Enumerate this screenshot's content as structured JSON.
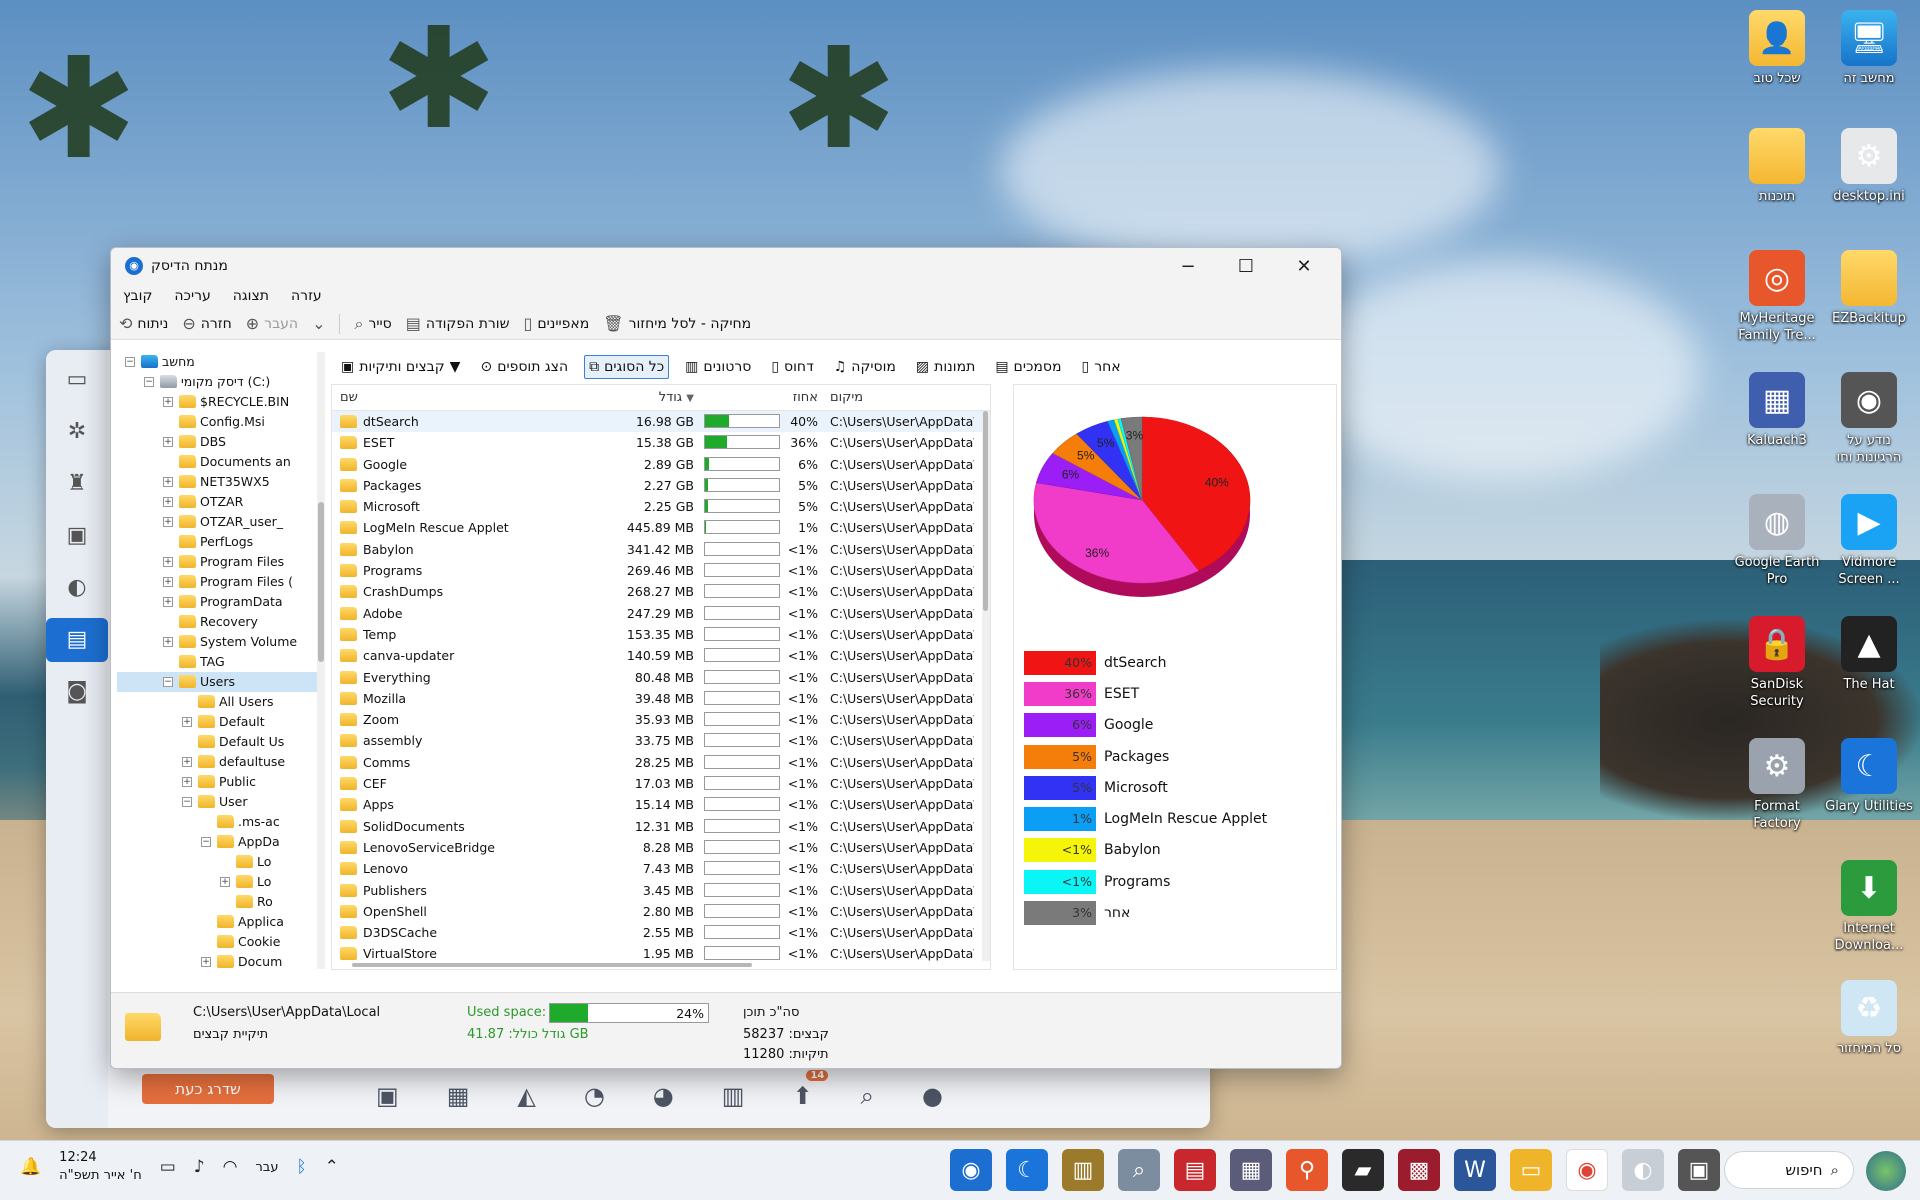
{
  "window": {
    "title": "מנתח הדיסק",
    "menu": [
      "קובץ",
      "עריכה",
      "תצוגה",
      "עזרה"
    ],
    "toolbar": {
      "analyze": "ניתוח",
      "back": "חזרה",
      "forward": "העבר",
      "explore": "סייר",
      "command_line": "שורת הפקודה",
      "properties": "מאפיינים",
      "recycle": "מחיקה - לסל מיחזור"
    },
    "category_tabs": {
      "files_folders": "קבצים ותיקיות",
      "show_extras": "הצג תוספים",
      "all_types": "כל הסוגים",
      "videos": "סרטונים",
      "reports": "דחוס",
      "music": "מוסיקה",
      "images": "תמונות",
      "documents": "מסמכים",
      "other": "אחר"
    }
  },
  "tree": {
    "items": [
      {
        "label": "מחשב",
        "level": 0,
        "exp": "−",
        "kind": "computer"
      },
      {
        "label": "דיסק מקומי (C:)",
        "level": 1,
        "exp": "−",
        "kind": "drive"
      },
      {
        "label": "$RECYCLE.BIN",
        "level": 2,
        "exp": "+"
      },
      {
        "label": "Config.Msi",
        "level": 2,
        "exp": ""
      },
      {
        "label": "DBS",
        "level": 2,
        "exp": "+"
      },
      {
        "label": "Documents an",
        "level": 2,
        "exp": ""
      },
      {
        "label": "NET35WX5",
        "level": 2,
        "exp": "+"
      },
      {
        "label": "OTZAR",
        "level": 2,
        "exp": "+"
      },
      {
        "label": "OTZAR_user_",
        "level": 2,
        "exp": "+"
      },
      {
        "label": "PerfLogs",
        "level": 2,
        "exp": ""
      },
      {
        "label": "Program Files",
        "level": 2,
        "exp": "+"
      },
      {
        "label": "Program Files (",
        "level": 2,
        "exp": "+"
      },
      {
        "label": "ProgramData",
        "level": 2,
        "exp": "+"
      },
      {
        "label": "Recovery",
        "level": 2,
        "exp": ""
      },
      {
        "label": "System Volume",
        "level": 2,
        "exp": "+"
      },
      {
        "label": "TAG",
        "level": 2,
        "exp": ""
      },
      {
        "label": "Users",
        "level": 2,
        "exp": "−",
        "selected": true
      },
      {
        "label": "All Users",
        "level": 3,
        "exp": ""
      },
      {
        "label": "Default",
        "level": 3,
        "exp": "+"
      },
      {
        "label": "Default Us",
        "level": 3,
        "exp": ""
      },
      {
        "label": "defaultuse",
        "level": 3,
        "exp": "+"
      },
      {
        "label": "Public",
        "level": 3,
        "exp": "+"
      },
      {
        "label": "User",
        "level": 3,
        "exp": "−"
      },
      {
        "label": ".ms-ac",
        "level": 4,
        "exp": ""
      },
      {
        "label": "AppDa",
        "level": 4,
        "exp": "−"
      },
      {
        "label": "Lo",
        "level": 5,
        "exp": ""
      },
      {
        "label": "Lo",
        "level": 5,
        "exp": "+"
      },
      {
        "label": "Ro",
        "level": 5,
        "exp": ""
      },
      {
        "label": "Applica",
        "level": 4,
        "exp": ""
      },
      {
        "label": "Cookie",
        "level": 4,
        "exp": ""
      },
      {
        "label": "Docum",
        "level": 4,
        "exp": "+"
      }
    ]
  },
  "list": {
    "headers": {
      "name": "שם",
      "size": "גודל",
      "pct": "אחוז",
      "location": "מיקום"
    },
    "rows": [
      {
        "name": "dtSearch",
        "size": "16.98 GB",
        "pct": "40%",
        "share": 0.4,
        "loc": "C:\\Users\\User\\AppData\\"
      },
      {
        "name": "ESET",
        "size": "15.38 GB",
        "pct": "36%",
        "share": 0.36,
        "loc": "C:\\Users\\User\\AppData\\"
      },
      {
        "name": "Google",
        "size": "2.89 GB",
        "pct": "6%",
        "share": 0.06,
        "loc": "C:\\Users\\User\\AppData\\"
      },
      {
        "name": "Packages",
        "size": "2.27 GB",
        "pct": "5%",
        "share": 0.05,
        "loc": "C:\\Users\\User\\AppData\\"
      },
      {
        "name": "Microsoft",
        "size": "2.25 GB",
        "pct": "5%",
        "share": 0.05,
        "loc": "C:\\Users\\User\\AppData\\"
      },
      {
        "name": "LogMeIn Rescue Applet",
        "size": "445.89 MB",
        "pct": "1%",
        "share": 0.01,
        "loc": "C:\\Users\\User\\AppData\\"
      },
      {
        "name": "Babylon",
        "size": "341.42 MB",
        "pct": "<1%",
        "share": 0.0,
        "loc": "C:\\Users\\User\\AppData\\"
      },
      {
        "name": "Programs",
        "size": "269.46 MB",
        "pct": "<1%",
        "share": 0.0,
        "loc": "C:\\Users\\User\\AppData\\"
      },
      {
        "name": "CrashDumps",
        "size": "268.27 MB",
        "pct": "<1%",
        "share": 0.0,
        "loc": "C:\\Users\\User\\AppData\\"
      },
      {
        "name": "Adobe",
        "size": "247.29 MB",
        "pct": "<1%",
        "share": 0.0,
        "loc": "C:\\Users\\User\\AppData\\"
      },
      {
        "name": "Temp",
        "size": "153.35 MB",
        "pct": "<1%",
        "share": 0.0,
        "loc": "C:\\Users\\User\\AppData\\"
      },
      {
        "name": "canva-updater",
        "size": "140.59 MB",
        "pct": "<1%",
        "share": 0.0,
        "loc": "C:\\Users\\User\\AppData\\"
      },
      {
        "name": "Everything",
        "size": "80.48 MB",
        "pct": "<1%",
        "share": 0.0,
        "loc": "C:\\Users\\User\\AppData\\"
      },
      {
        "name": "Mozilla",
        "size": "39.48 MB",
        "pct": "<1%",
        "share": 0.0,
        "loc": "C:\\Users\\User\\AppData\\"
      },
      {
        "name": "Zoom",
        "size": "35.93 MB",
        "pct": "<1%",
        "share": 0.0,
        "loc": "C:\\Users\\User\\AppData\\"
      },
      {
        "name": "assembly",
        "size": "33.75 MB",
        "pct": "<1%",
        "share": 0.0,
        "loc": "C:\\Users\\User\\AppData\\"
      },
      {
        "name": "Comms",
        "size": "28.25 MB",
        "pct": "<1%",
        "share": 0.0,
        "loc": "C:\\Users\\User\\AppData\\"
      },
      {
        "name": "CEF",
        "size": "17.03 MB",
        "pct": "<1%",
        "share": 0.0,
        "loc": "C:\\Users\\User\\AppData\\"
      },
      {
        "name": "Apps",
        "size": "15.14 MB",
        "pct": "<1%",
        "share": 0.0,
        "loc": "C:\\Users\\User\\AppData\\"
      },
      {
        "name": "SolidDocuments",
        "size": "12.31 MB",
        "pct": "<1%",
        "share": 0.0,
        "loc": "C:\\Users\\User\\AppData\\"
      },
      {
        "name": "LenovoServiceBridge",
        "size": "8.28 MB",
        "pct": "<1%",
        "share": 0.0,
        "loc": "C:\\Users\\User\\AppData\\"
      },
      {
        "name": "Lenovo",
        "size": "7.43 MB",
        "pct": "<1%",
        "share": 0.0,
        "loc": "C:\\Users\\User\\AppData\\"
      },
      {
        "name": "Publishers",
        "size": "3.45 MB",
        "pct": "<1%",
        "share": 0.0,
        "loc": "C:\\Users\\User\\AppData\\"
      },
      {
        "name": "OpenShell",
        "size": "2.80 MB",
        "pct": "<1%",
        "share": 0.0,
        "loc": "C:\\Users\\User\\AppData\\"
      },
      {
        "name": "D3DSCache",
        "size": "2.55 MB",
        "pct": "<1%",
        "share": 0.0,
        "loc": "C:\\Users\\User\\AppData\\"
      },
      {
        "name": "VirtualStore",
        "size": "1.95 MB",
        "pct": "<1%",
        "share": 0.0,
        "loc": "C:\\Users\\User\\AppData\\"
      }
    ]
  },
  "chart_data": {
    "type": "pie",
    "slices": [
      {
        "name": "dtSearch",
        "value": 40,
        "label": "40%",
        "color": "#f01414"
      },
      {
        "name": "ESET",
        "value": 36,
        "label": "36%",
        "color": "#f03cc8"
      },
      {
        "name": "Google",
        "value": 6,
        "label": "6%",
        "color": "#9a1ef5"
      },
      {
        "name": "Packages",
        "value": 5,
        "label": "5%",
        "color": "#f57d0a"
      },
      {
        "name": "Microsoft",
        "value": 5,
        "label": "5%",
        "color": "#3232f5"
      },
      {
        "name": "LogMeIn Rescue Applet",
        "value": 1,
        "label": "1%",
        "color": "#0a9ef5"
      },
      {
        "name": "Babylon",
        "value": 0.5,
        "label": "<1%",
        "color": "#f5f50a"
      },
      {
        "name": "Programs",
        "value": 0.5,
        "label": "<1%",
        "color": "#0af5f5"
      },
      {
        "name": "אחר",
        "value": 3,
        "label": "3%",
        "color": "#7a7a7a"
      }
    ]
  },
  "status": {
    "path": "C:\\Users\\User\\AppData\\Local",
    "type": "תיקיית קבצים",
    "used_label": "Used space:",
    "used_pct": "24%",
    "used_value": 0.24,
    "total": "גודל כולל: 41.87 GB",
    "summary_title": "סה\"כ תוכן",
    "files": "קבצים: 58237",
    "folders": "תיקיות: 11280"
  },
  "desktop": {
    "icons": [
      {
        "label": "מחשב זה",
        "glyph": "🖥",
        "kind": "pc"
      },
      {
        "label": "שכל טוב",
        "glyph": "👤",
        "kind": "folder"
      },
      {
        "label": "desktop.ini",
        "glyph": "⚙",
        "kind": "file"
      },
      {
        "label": "תוכנות",
        "glyph": "",
        "kind": "folder"
      },
      {
        "label": "EZBackitup",
        "glyph": "",
        "kind": "folder"
      },
      {
        "label": "MyHeritage Family Tre...",
        "glyph": "◎",
        "kind": "app",
        "color": "#e8572b"
      },
      {
        "label": "נודע על הרגיונות וחו",
        "glyph": "◉",
        "kind": "app",
        "color": "#555"
      },
      {
        "label": "Kaluach3",
        "glyph": "▦",
        "kind": "app",
        "color": "#3f5fae"
      },
      {
        "label": "Vidmore Screen ...",
        "glyph": "▶",
        "kind": "app",
        "color": "#1aa3f5"
      },
      {
        "label": "Google Earth Pro",
        "glyph": "◍",
        "kind": "app",
        "color": "#a9b1bd"
      },
      {
        "label": "The Hat",
        "glyph": "▲",
        "kind": "app",
        "color": "#222"
      },
      {
        "label": "SanDisk Security",
        "glyph": "🔒",
        "kind": "app",
        "color": "#d81b2c"
      },
      {
        "label": "Glary Utilities",
        "glyph": "☾",
        "kind": "app",
        "color": "#1a74d9"
      },
      {
        "label": "Format Factory",
        "glyph": "⚙",
        "kind": "app",
        "color": "#9aa3ad"
      },
      {
        "label": "Internet Downloa...",
        "glyph": "⬇",
        "kind": "app",
        "color": "#2b9b3d"
      },
      {
        "label": "סל המיחזור",
        "glyph": "♻",
        "kind": "app",
        "color": "#cfe6f5"
      }
    ]
  },
  "background_app": {
    "upgrade": "שדרג כעת",
    "badge": "14"
  },
  "taskbar": {
    "time": "12:24",
    "date": "ח' אייר תשפ\"ה",
    "lang": "עבר",
    "search": "חיפוש"
  }
}
